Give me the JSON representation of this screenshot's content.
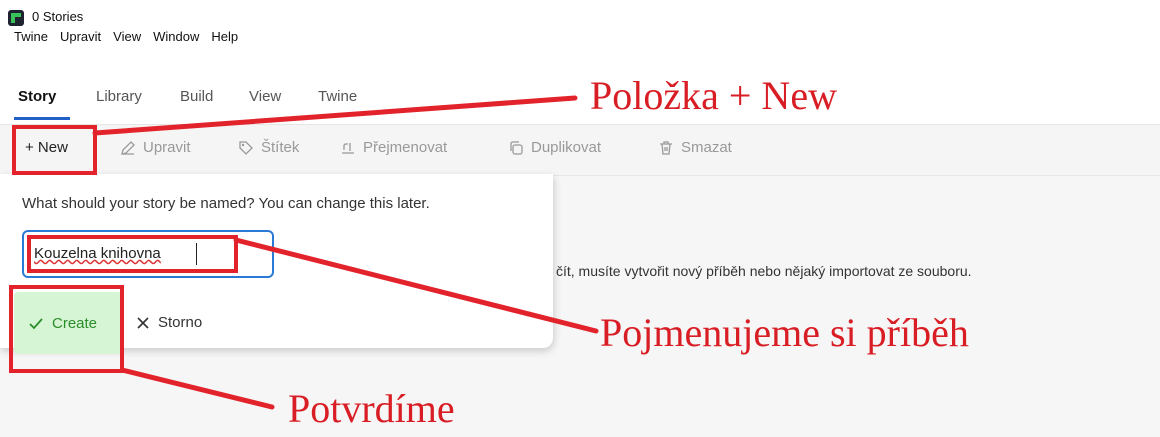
{
  "window": {
    "title": "0 Stories"
  },
  "menu": [
    "Twine",
    "Upravit",
    "View",
    "Window",
    "Help"
  ],
  "tabs": [
    {
      "label": "Story",
      "active": true
    },
    {
      "label": "Library"
    },
    {
      "label": "Build"
    },
    {
      "label": "View"
    },
    {
      "label": "Twine"
    }
  ],
  "toolbar": {
    "new": "+ New",
    "edit": "Upravit",
    "tag": "Štítek",
    "rename": "Přejmenovat",
    "duplicate": "Duplikovat",
    "delete": "Smazat"
  },
  "dialog": {
    "prompt": "What should your story be named? You can change this later.",
    "input_value": "Kouzelna knihovna",
    "create_label": "Create",
    "cancel_label": "Storno"
  },
  "empty_message": "čít, musíte vytvořit nový příběh nebo nějaký importovat ze souboru.",
  "annotations": {
    "new_item": "Položka + New",
    "name_story": "Pojmenujeme si příběh",
    "confirm": "Potvrdíme"
  },
  "colors": {
    "annotation": "#e3232b",
    "accent": "#2b7bd6",
    "create_bg": "#d6f5d4"
  }
}
